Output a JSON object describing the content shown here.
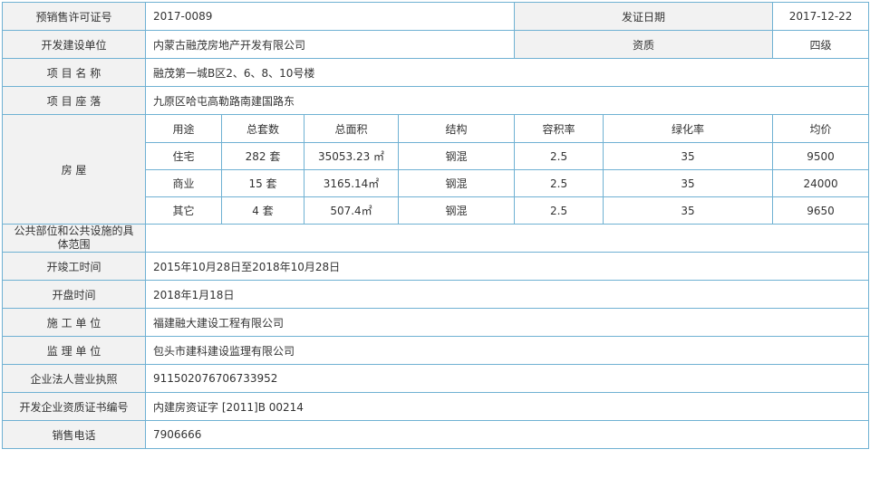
{
  "presale_permit": {
    "label": "预销售许可证号",
    "value": "2017-0089"
  },
  "issue_date": {
    "label": "发证日期",
    "value": "2017-12-22"
  },
  "developer": {
    "label": "开发建设单位",
    "value": "内蒙古融茂房地产开发有限公司"
  },
  "qualification": {
    "label": "资质",
    "value": "四级"
  },
  "project_name": {
    "label": "项 目 名 称",
    "value": "融茂第一城B区2、6、8、10号楼"
  },
  "project_location": {
    "label": "项 目 座 落",
    "value": "九原区哈屯高勒路南建国路东"
  },
  "housing": {
    "label": "房 屋",
    "headers": [
      "用途",
      "总套数",
      "总面积",
      "结构",
      "容积率",
      "绿化率",
      "均价"
    ],
    "rows": [
      [
        "住宅",
        "282 套",
        "35053.23 ㎡",
        "钢混",
        "2.5",
        "35",
        "9500"
      ],
      [
        "商业",
        "15 套",
        "3165.14㎡",
        "钢混",
        "2.5",
        "35",
        "24000"
      ],
      [
        "其它",
        "4 套",
        "507.4㎡",
        "钢混",
        "2.5",
        "35",
        "9650"
      ]
    ]
  },
  "public_facilities": {
    "label": "公共部位和公共设施的具体范围",
    "value": ""
  },
  "construction_period": {
    "label": "开竣工时间",
    "value": "2015年10月28日至2018年10月28日"
  },
  "opening_date": {
    "label": "开盘时间",
    "value": "2018年1月18日"
  },
  "contractor": {
    "label": "施 工 单 位",
    "value": "福建融大建设工程有限公司"
  },
  "supervisor": {
    "label": "监 理 单 位",
    "value": "包头市建科建设监理有限公司"
  },
  "business_license": {
    "label": "企业法人营业执照",
    "value": "911502076706733952"
  },
  "qualification_cert": {
    "label": "开发企业资质证书编号",
    "value": "内建房资证字 [2011]B 00214"
  },
  "sales_phone": {
    "label": "销售电话",
    "value": "7906666"
  }
}
